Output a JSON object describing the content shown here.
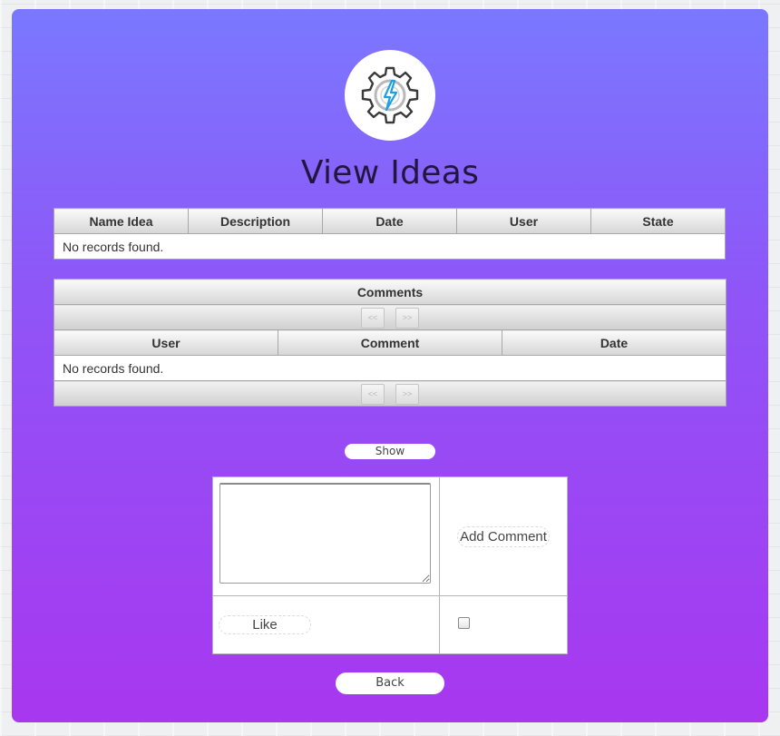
{
  "page": {
    "title": "View Ideas",
    "logo_icon": "gear-lightning-icon",
    "accent_top": "#7a78ff",
    "accent_bottom": "#a837f0"
  },
  "ideas_table": {
    "columns": [
      "Name Idea",
      "Description",
      "Date",
      "User",
      "State"
    ],
    "empty_message": "No records found."
  },
  "comments_table": {
    "caption": "Comments",
    "columns": [
      "User",
      "Comment",
      "Date"
    ],
    "empty_message": "No records found.",
    "pager": {
      "prev_icon": "prev-page-icon",
      "next_icon": "next-page-icon"
    }
  },
  "actions": {
    "show_label": "Show",
    "add_comment_label": "Add Comment",
    "like_label": "Like",
    "back_label": "Back",
    "comment_value": "",
    "like_checked": false
  }
}
